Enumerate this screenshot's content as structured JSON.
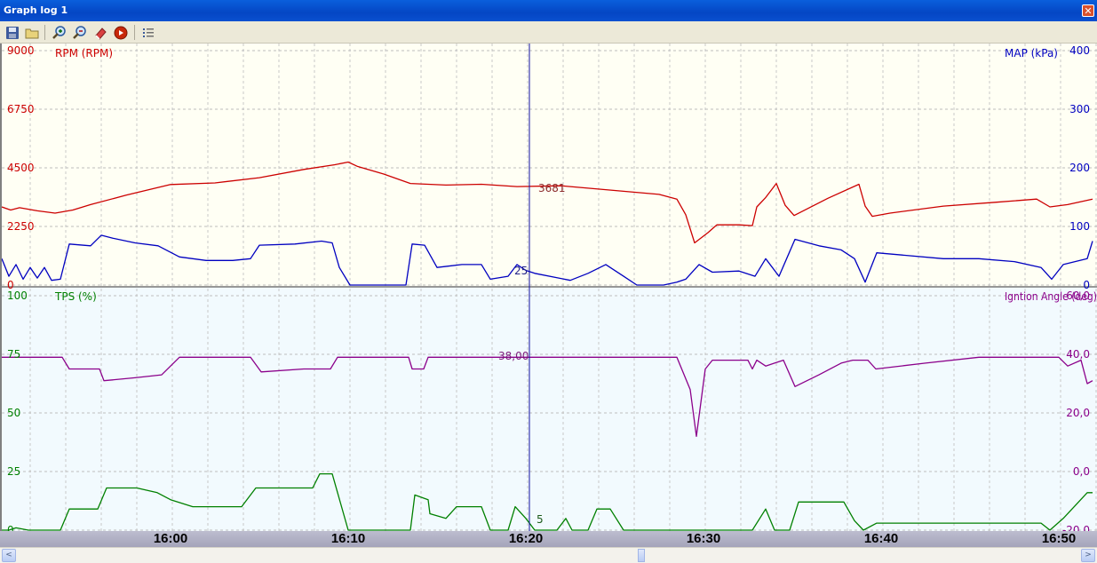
{
  "window": {
    "title": "Graph log 1",
    "close_icon": "close-icon"
  },
  "toolbar": {
    "icons": [
      "save-icon",
      "open-folder-icon",
      "zoom-in-icon",
      "zoom-out-icon",
      "eraser-icon",
      "record-icon",
      "list-icon"
    ]
  },
  "colors": {
    "rpm": "#cc0000",
    "map": "#0000c0",
    "tps": "#008000",
    "ign": "#8b008b",
    "upper_bg": "#fffff4",
    "lower_bg": "#f2fafe"
  },
  "cursor": {
    "time": "16:20",
    "rpm_value": "3681",
    "map_value": "25",
    "ign_value": "38,00",
    "tps_value": "5"
  },
  "chart_data": [
    {
      "type": "line",
      "panel": "upper",
      "left_axis": {
        "label": "RPM (RPM)",
        "ticks": [
          "9000",
          "6750",
          "4500",
          "2250",
          "0"
        ],
        "range": [
          0,
          9000
        ]
      },
      "right_axis": {
        "label": "MAP (kPa)",
        "ticks": [
          "400",
          "300",
          "200",
          "100",
          "0"
        ],
        "range": [
          0,
          400
        ]
      },
      "x": {
        "start": 15.87,
        "end": 16.89,
        "tick_labels": [
          "16:00",
          "16:10",
          "16:20",
          "16:30",
          "16:40",
          "16:50"
        ]
      },
      "grid": true,
      "series": [
        {
          "name": "RPM (RPM)",
          "axis": "left",
          "points": [
            [
              0,
              3000
            ],
            [
              10,
              2880
            ],
            [
              20,
              2970
            ],
            [
              40,
              2850
            ],
            [
              60,
              2760
            ],
            [
              80,
              2880
            ],
            [
              100,
              3090
            ],
            [
              140,
              3450
            ],
            [
              190,
              3860
            ],
            [
              240,
              3920
            ],
            [
              290,
              4120
            ],
            [
              340,
              4440
            ],
            [
              375,
              4620
            ],
            [
              390,
              4720
            ],
            [
              400,
              4560
            ],
            [
              430,
              4260
            ],
            [
              460,
              3900
            ],
            [
              500,
              3840
            ],
            [
              540,
              3870
            ],
            [
              580,
              3780
            ],
            [
              630,
              3810
            ],
            [
              640,
              3780
            ],
            [
              700,
              3600
            ],
            [
              740,
              3480
            ],
            [
              760,
              3300
            ],
            [
              770,
              2700
            ],
            [
              780,
              1620
            ],
            [
              795,
              2010
            ],
            [
              805,
              2310
            ],
            [
              830,
              2310
            ],
            [
              845,
              2280
            ],
            [
              850,
              3000
            ],
            [
              860,
              3360
            ],
            [
              872,
              3900
            ],
            [
              882,
              3060
            ],
            [
              892,
              2670
            ],
            [
              930,
              3330
            ],
            [
              965,
              3870
            ],
            [
              972,
              3030
            ],
            [
              980,
              2640
            ],
            [
              1000,
              2760
            ],
            [
              1060,
              3030
            ],
            [
              1120,
              3180
            ],
            [
              1165,
              3300
            ],
            [
              1180,
              3000
            ],
            [
              1200,
              3090
            ],
            [
              1228,
              3300
            ]
          ]
        },
        {
          "name": "MAP (kPa)",
          "axis": "right",
          "points": [
            [
              0,
              45
            ],
            [
              8,
              15
            ],
            [
              16,
              35
            ],
            [
              24,
              10
            ],
            [
              32,
              30
            ],
            [
              40,
              12
            ],
            [
              48,
              30
            ],
            [
              56,
              8
            ],
            [
              66,
              10
            ],
            [
              76,
              70
            ],
            [
              100,
              67
            ],
            [
              112,
              85
            ],
            [
              125,
              80
            ],
            [
              150,
              72
            ],
            [
              176,
              67
            ],
            [
              200,
              48
            ],
            [
              230,
              42
            ],
            [
              260,
              42
            ],
            [
              280,
              45
            ],
            [
              290,
              68
            ],
            [
              330,
              70
            ],
            [
              360,
              75
            ],
            [
              372,
              72
            ],
            [
              380,
              30
            ],
            [
              392,
              0
            ],
            [
              455,
              0
            ],
            [
              462,
              70
            ],
            [
              476,
              68
            ],
            [
              490,
              30
            ],
            [
              518,
              35
            ],
            [
              540,
              35
            ],
            [
              550,
              10
            ],
            [
              570,
              15
            ],
            [
              580,
              35
            ],
            [
              590,
              25
            ],
            [
              600,
              20
            ],
            [
              640,
              8
            ],
            [
              660,
              20
            ],
            [
              680,
              35
            ],
            [
              700,
              15
            ],
            [
              715,
              0
            ],
            [
              745,
              0
            ],
            [
              760,
              5
            ],
            [
              770,
              10
            ],
            [
              785,
              35
            ],
            [
              800,
              22
            ],
            [
              830,
              24
            ],
            [
              848,
              15
            ],
            [
              860,
              45
            ],
            [
              875,
              15
            ],
            [
              893,
              78
            ],
            [
              920,
              67
            ],
            [
              945,
              60
            ],
            [
              960,
              45
            ],
            [
              972,
              5
            ],
            [
              985,
              55
            ],
            [
              1060,
              45
            ],
            [
              1100,
              45
            ],
            [
              1140,
              40
            ],
            [
              1170,
              30
            ],
            [
              1182,
              10
            ],
            [
              1195,
              35
            ],
            [
              1222,
              45
            ],
            [
              1228,
              75
            ]
          ]
        }
      ]
    },
    {
      "type": "line",
      "panel": "lower",
      "left_axis": {
        "label": "TPS (%)",
        "ticks": [
          "100",
          "75",
          "50",
          "25",
          "0"
        ],
        "range": [
          0,
          100
        ]
      },
      "right_axis": {
        "label": "Igntion Angle (deg)",
        "ticks": [
          "60,0",
          "40,0",
          "20,0",
          "0,0",
          "-20,0"
        ],
        "range": [
          -20,
          60
        ]
      },
      "x": {
        "start": 15.87,
        "end": 16.89
      },
      "grid": true,
      "series": [
        {
          "name": "TPS (%)",
          "axis": "left",
          "points": [
            [
              0,
              0
            ],
            [
              8,
              0
            ],
            [
              16,
              1
            ],
            [
              30,
              0
            ],
            [
              40,
              0
            ],
            [
              66,
              0
            ],
            [
              76,
              9
            ],
            [
              108,
              9
            ],
            [
              118,
              18
            ],
            [
              152,
              18
            ],
            [
              175,
              16
            ],
            [
              190,
              13
            ],
            [
              215,
              10
            ],
            [
              270,
              10
            ],
            [
              286,
              18
            ],
            [
              350,
              18
            ],
            [
              358,
              24
            ],
            [
              372,
              24
            ],
            [
              390,
              0
            ],
            [
              460,
              0
            ],
            [
              465,
              15
            ],
            [
              480,
              13
            ],
            [
              482,
              7
            ],
            [
              500,
              5
            ],
            [
              512,
              10
            ],
            [
              540,
              10
            ],
            [
              550,
              0
            ],
            [
              570,
              0
            ],
            [
              578,
              10
            ],
            [
              590,
              5
            ],
            [
              600,
              0
            ],
            [
              625,
              0
            ],
            [
              635,
              5
            ],
            [
              642,
              0
            ],
            [
              660,
              0
            ],
            [
              670,
              9
            ],
            [
              685,
              9
            ],
            [
              700,
              0
            ],
            [
              715,
              0
            ],
            [
              760,
              0
            ],
            [
              780,
              0
            ],
            [
              800,
              0
            ],
            [
              845,
              0
            ],
            [
              860,
              9
            ],
            [
              870,
              0
            ],
            [
              887,
              0
            ],
            [
              897,
              12
            ],
            [
              948,
              12
            ],
            [
              960,
              4
            ],
            [
              970,
              0
            ],
            [
              985,
              3
            ],
            [
              1170,
              3
            ],
            [
              1180,
              0
            ],
            [
              1195,
              5
            ],
            [
              1222,
              16
            ],
            [
              1228,
              16
            ]
          ]
        },
        {
          "name": "Igntion Angle (deg)",
          "axis": "right",
          "points": [
            [
              0,
              39
            ],
            [
              30,
              39
            ],
            [
              60,
              39
            ],
            [
              68,
              39
            ],
            [
              76,
              35
            ],
            [
              110,
              35
            ],
            [
              115,
              31
            ],
            [
              150,
              32
            ],
            [
              180,
              33
            ],
            [
              200,
              39
            ],
            [
              270,
              39
            ],
            [
              280,
              39
            ],
            [
              292,
              34
            ],
            [
              340,
              35
            ],
            [
              370,
              35
            ],
            [
              378,
              39
            ],
            [
              458,
              39
            ],
            [
              462,
              35
            ],
            [
              475,
              35
            ],
            [
              480,
              39
            ],
            [
              760,
              39
            ],
            [
              775,
              28
            ],
            [
              782,
              12
            ],
            [
              792,
              35
            ],
            [
              800,
              38
            ],
            [
              840,
              38
            ],
            [
              845,
              35
            ],
            [
              850,
              38
            ],
            [
              860,
              36
            ],
            [
              870,
              37
            ],
            [
              880,
              38
            ],
            [
              893,
              29
            ],
            [
              920,
              33
            ],
            [
              945,
              37
            ],
            [
              958,
              38
            ],
            [
              975,
              38
            ],
            [
              984,
              35
            ],
            [
              1040,
              37
            ],
            [
              1100,
              39
            ],
            [
              1150,
              39
            ],
            [
              1190,
              39
            ],
            [
              1200,
              36
            ],
            [
              1215,
              38
            ],
            [
              1222,
              30
            ],
            [
              1228,
              31
            ]
          ]
        }
      ]
    }
  ]
}
